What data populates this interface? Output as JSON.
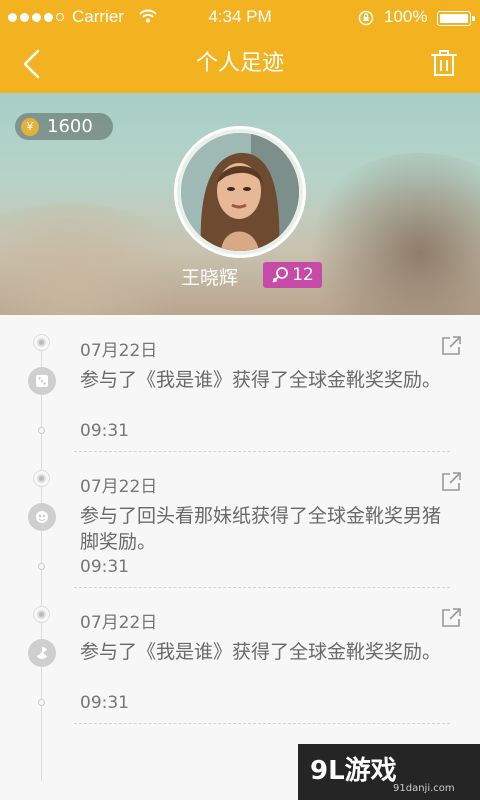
{
  "status_bar": {
    "carrier": "Carrier",
    "time": "4:34 PM",
    "battery": "100%"
  },
  "header": {
    "title": "个人足迹",
    "back_icon": "chevron-left-icon",
    "delete_icon": "trash-icon",
    "color": "#f3b321"
  },
  "profile": {
    "coins": "1600",
    "coin_icon": "yen-coin-icon",
    "name": "王晓辉",
    "level": "12",
    "gender_icon": "female-icon",
    "badge_color": "#c74aa8"
  },
  "entries": [
    {
      "date": "07月22日",
      "text": "参与了《我是谁》获得了全球金靴奖奖励。",
      "time": "09:31",
      "icon": "dice-icon"
    },
    {
      "date": "07月22日",
      "text": "参与了回头看那妹纸获得了全球金靴奖男猪脚奖励。",
      "time": "09:31",
      "icon": "mask-icon"
    },
    {
      "date": "07月22日",
      "text": "参与了《我是谁》获得了全球金靴奖奖励。",
      "time": "09:31",
      "icon": "radiation-icon"
    }
  ],
  "watermark": {
    "brand": "9L游戏",
    "site": "91danji.com"
  }
}
